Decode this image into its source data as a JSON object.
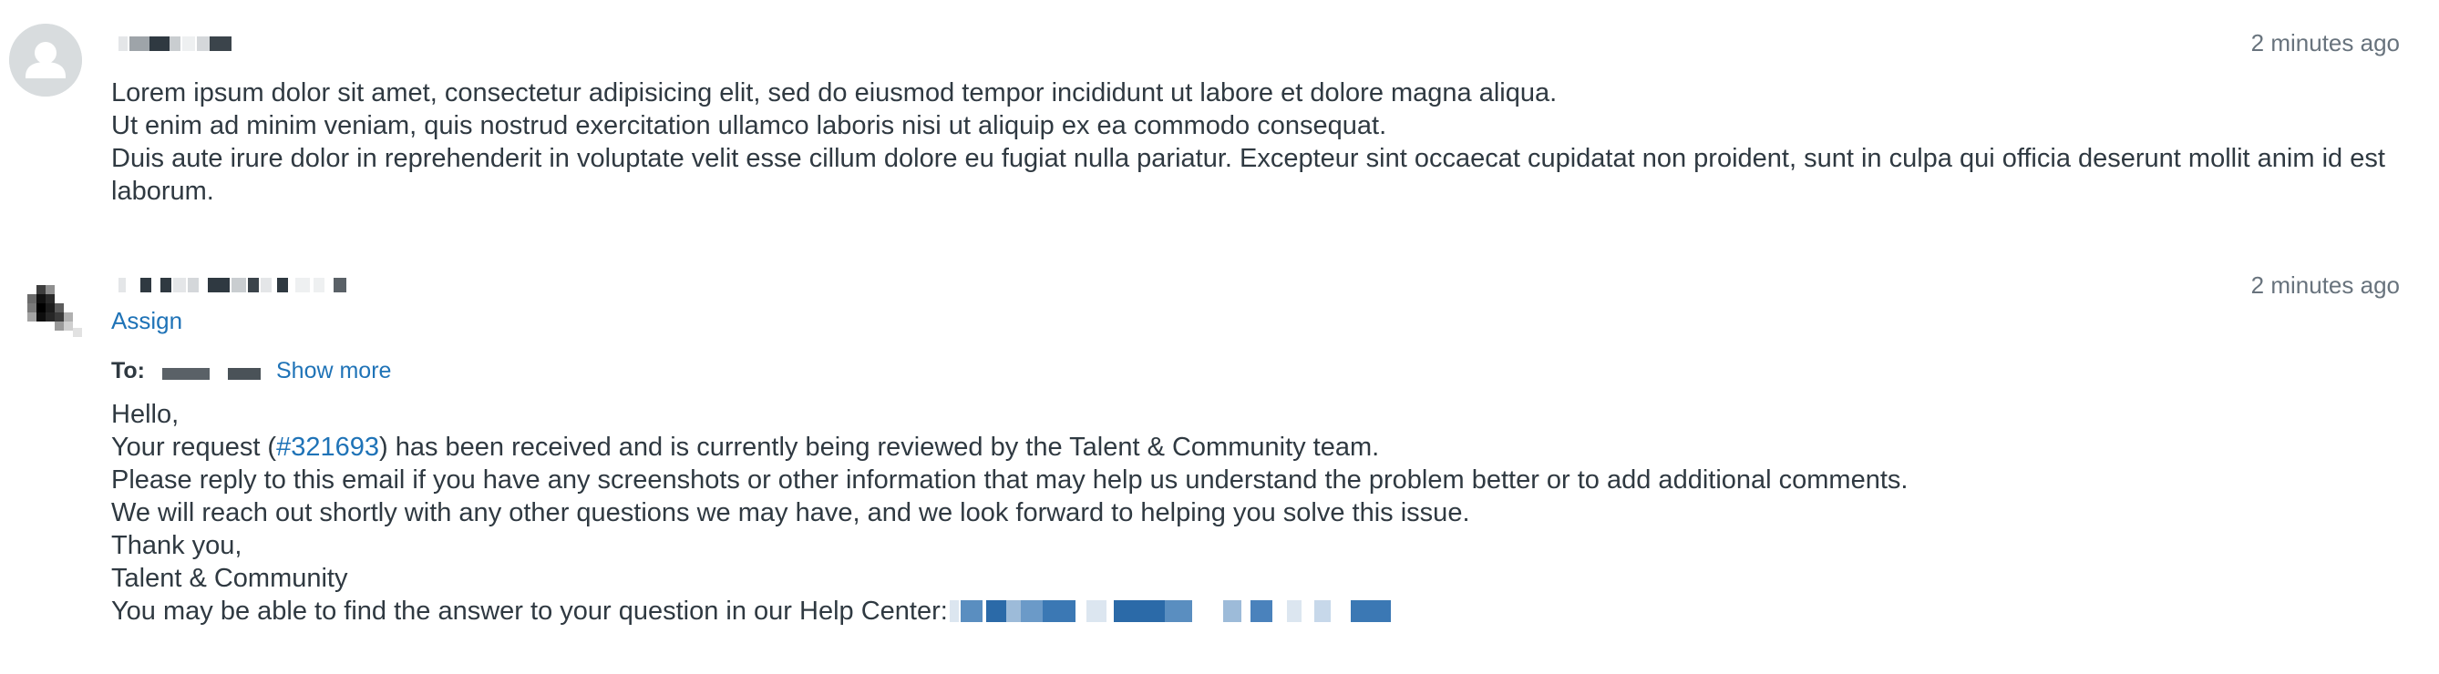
{
  "comments": [
    {
      "author_redacted": true,
      "timestamp": "2 minutes ago",
      "body_lines": [
        "Lorem ipsum dolor sit amet, consectetur adipisicing elit, sed do eiusmod tempor incididunt ut labore et dolore magna aliqua.",
        "Ut enim ad minim veniam, quis nostrud exercitation ullamco laboris nisi ut aliquip ex ea commodo consequat.",
        "Duis aute irure dolor in reprehenderit in voluptate velit esse cillum dolore eu fugiat nulla pariatur. Excepteur sint occaecat cupidatat non proident, sunt in culpa qui officia deserunt mollit anim id est laborum."
      ]
    },
    {
      "author_redacted": true,
      "timestamp": "2 minutes ago",
      "assign_label": "Assign",
      "to_label": "To:",
      "show_more_label": "Show more",
      "greeting": "Hello,",
      "request_prefix": "Your request (",
      "ticket_id": "#321693",
      "request_suffix": ") has been received and is currently being reviewed by the Talent & Community team.",
      "line_reply": "Please reply to this email if you have any screenshots or other information that may help us understand the problem better or to add additional comments.",
      "line_reach": "We will reach out shortly with any other questions we may have, and we look forward to helping you solve this issue.",
      "sign_off": "Thank you,",
      "signature": "Talent & Community",
      "help_center_text": "You may be able to find the answer to your question in our Help Center:"
    }
  ],
  "colors": {
    "link": "#1f73b7",
    "text": "#2f3941",
    "muted": "#68737d",
    "avatar_bg": "#d8dcde"
  },
  "icons": {
    "default_avatar": "user-silhouette-icon"
  }
}
